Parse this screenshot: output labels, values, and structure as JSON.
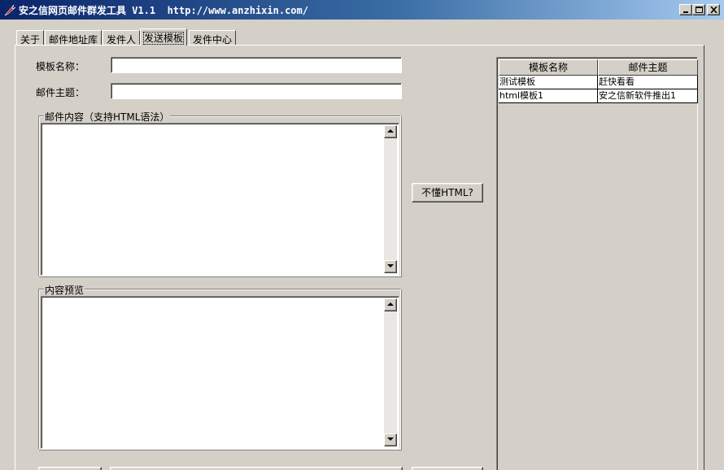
{
  "window": {
    "title": "安之信网页邮件群发工具 V1.1  http://www.anzhixin.com/"
  },
  "tabs": [
    "关于",
    "邮件地址库",
    "发件人",
    "发送模板",
    "发件中心"
  ],
  "form": {
    "template_name_label": "模板名称：",
    "template_name_value": "",
    "subject_label": "邮件主题：",
    "subject_value": "",
    "content_legend": "邮件内容（支持HTML语法）",
    "content_value": "",
    "preview_legend": "内容预览",
    "preview_value": ""
  },
  "buttons": {
    "html_help": "不懂HTML?"
  },
  "template_list": {
    "columns": [
      "模板名称",
      "邮件主题"
    ],
    "rows": [
      [
        "测试模板",
        "赶快看看"
      ],
      [
        "html模板1",
        "安之信新软件推出1"
      ]
    ]
  },
  "colors": {
    "title_bar_start": "#0a246a",
    "title_bar_end": "#a6caf0",
    "window_face": "#d4d0c8"
  }
}
